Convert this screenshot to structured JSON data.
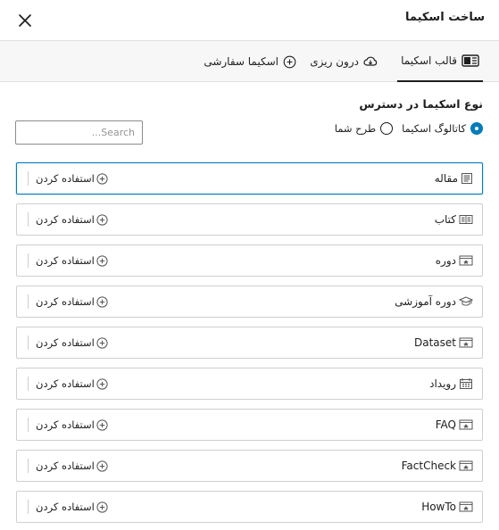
{
  "header": {
    "title": "ساخت اسکیما"
  },
  "tabs": [
    {
      "label": "قالب اسکیما",
      "icon": "template-icon",
      "active": true
    },
    {
      "label": "درون ریزی",
      "icon": "cloud-import-icon",
      "active": false
    },
    {
      "label": "اسکیما سفارشی",
      "icon": "plus-circle-icon",
      "active": false
    }
  ],
  "type_section": {
    "heading": "نوع اسکیما در دسترس",
    "options": [
      {
        "label": "کاتالوگ اسکیما",
        "checked": true
      },
      {
        "label": "طرح شما",
        "checked": false
      }
    ]
  },
  "search": {
    "placeholder": "Search...",
    "value": ""
  },
  "use_label": "استفاده کردن",
  "schemas": [
    {
      "name": "مقاله",
      "icon": "article-icon"
    },
    {
      "name": "کتاب",
      "icon": "book-icon"
    },
    {
      "name": "دوره",
      "icon": "course-icon"
    },
    {
      "name": "دوره آموزشی",
      "icon": "graduation-cap-icon"
    },
    {
      "name": "Dataset",
      "icon": "dataset-icon"
    },
    {
      "name": "رویداد",
      "icon": "calendar-icon"
    },
    {
      "name": "FAQ",
      "icon": "faq-icon"
    },
    {
      "name": "FactCheck",
      "icon": "factcheck-icon"
    },
    {
      "name": "HowTo",
      "icon": "howto-icon"
    }
  ],
  "colors": {
    "accent": "#007cba",
    "border": "#cfcfcf",
    "tab_bg": "#f7f7f7",
    "text": "#1e1e1e"
  }
}
